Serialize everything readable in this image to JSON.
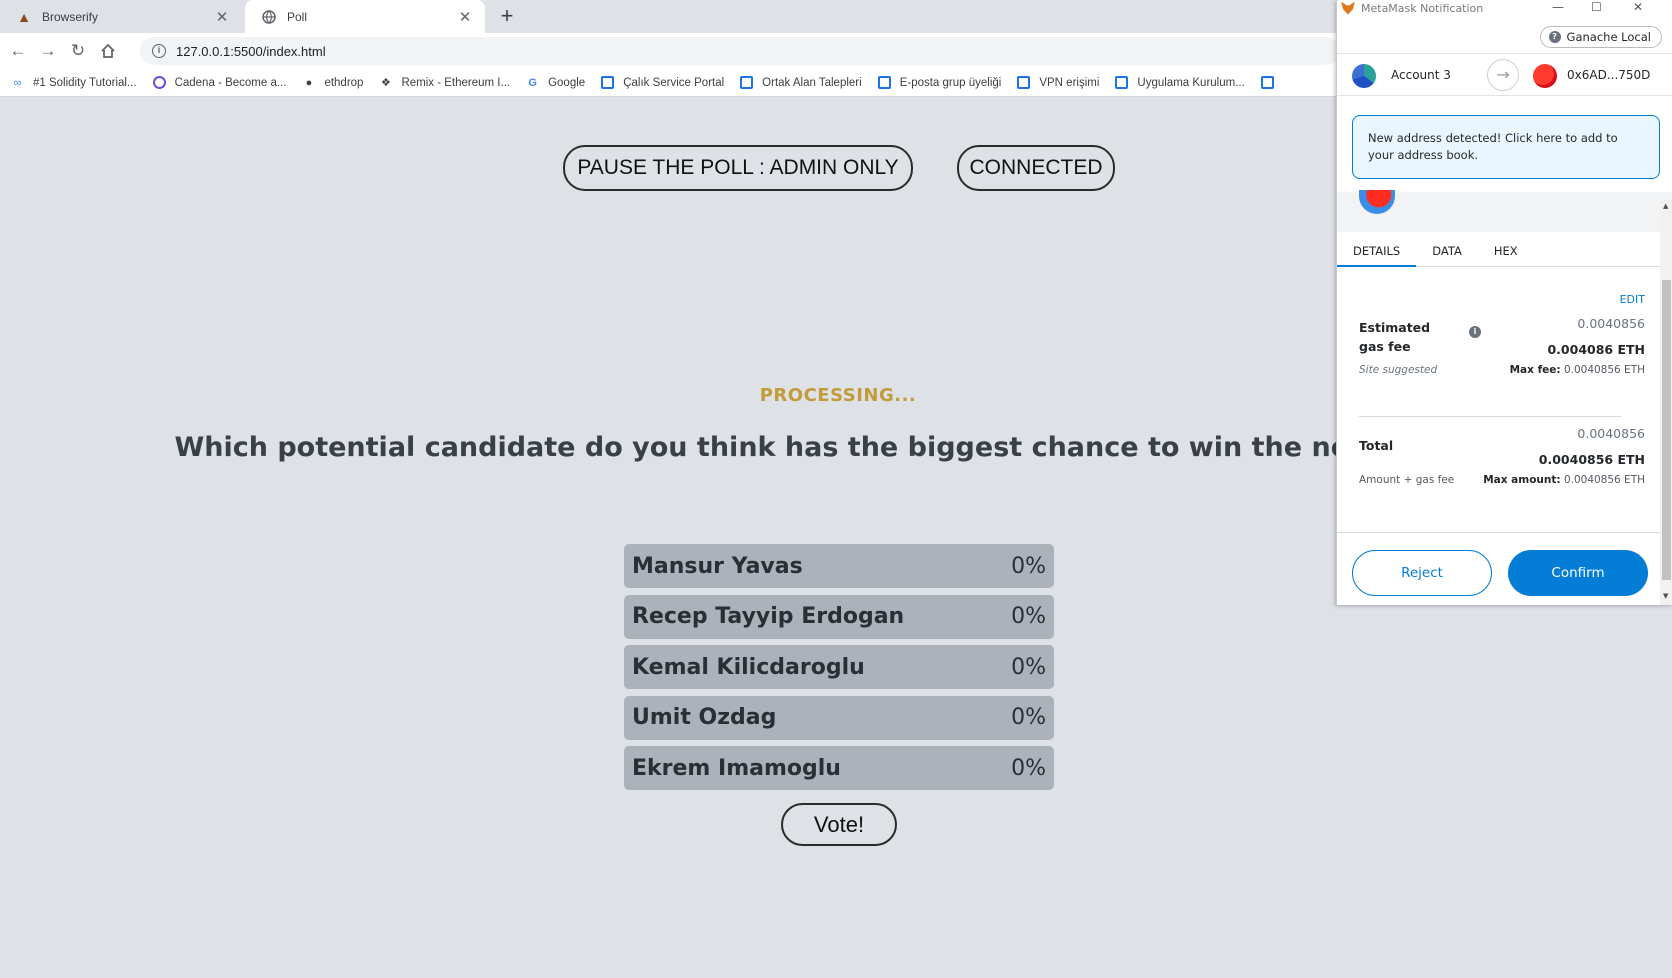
{
  "browser": {
    "tabs": [
      {
        "title": "Browserify",
        "active": false,
        "icon": "hat-icon"
      },
      {
        "title": "Poll",
        "active": true,
        "icon": "globe-icon"
      }
    ],
    "url": "127.0.0.1:5500/index.html",
    "bookmarks": [
      {
        "label": "#1 Solidity Tutorial...",
        "icon": "link-icon"
      },
      {
        "label": "Cadena - Become a...",
        "icon": "circle-icon"
      },
      {
        "label": "ethdrop",
        "icon": "drop-icon"
      },
      {
        "label": "Remix - Ethereum I...",
        "icon": "remix-icon"
      },
      {
        "label": "Google",
        "icon": "google-icon"
      },
      {
        "label": "Çalık Service Portal",
        "icon": "square-icon"
      },
      {
        "label": "Ortak Alan Talepleri",
        "icon": "square-icon"
      },
      {
        "label": "E-posta grup üyeliği",
        "icon": "square-icon"
      },
      {
        "label": "VPN erişimi",
        "icon": "square-icon"
      },
      {
        "label": "Uygulama Kurulum...",
        "icon": "square-icon"
      },
      {
        "label": "",
        "icon": "square-icon"
      }
    ]
  },
  "poll": {
    "pause_label": "PAUSE THE POLL : ADMIN ONLY",
    "connected_label": "CONNECTED",
    "status": "PROCESSING...",
    "question": "Which potential candidate do you think has the biggest chance to win the next Turkey?",
    "options": [
      {
        "name": "Mansur Yavas",
        "percent": "0%"
      },
      {
        "name": "Recep Tayyip Erdogan",
        "percent": "0%"
      },
      {
        "name": "Kemal Kilicdaroglu",
        "percent": "0%"
      },
      {
        "name": "Umit Ozdag",
        "percent": "0%"
      },
      {
        "name": "Ekrem Imamoglu",
        "percent": "0%"
      }
    ],
    "vote_label": "Vote!"
  },
  "metamask": {
    "window_title": "MetaMask Notification",
    "network": "Ganache Local",
    "from_account": "Account 3",
    "to_address": "0x6AD...750D",
    "notice": "New address detected! Click here to add to your address book.",
    "tabs": [
      "DETAILS",
      "DATA",
      "HEX"
    ],
    "edit_label": "EDIT",
    "gas_label": "Estimated gas fee",
    "gas_value": "0.0040856",
    "gas_eth": "0.004086 ETH",
    "site_suggested": "Site suggested",
    "max_fee_label": "Max fee:",
    "max_fee_value": "0.0040856 ETH",
    "total_label": "Total",
    "total_value": "0.0040856",
    "total_eth": "0.0040856 ETH",
    "amount_gas_label": "Amount + gas fee",
    "max_amount_label": "Max amount:",
    "max_amount_value": "0.0040856 ETH",
    "reject_label": "Reject",
    "confirm_label": "Confirm",
    "colors": {
      "primary": "#037dd6",
      "notice_bg": "#eaf6ff"
    }
  },
  "colors": {
    "page_bg": "#dee1e6",
    "status": "#c29b3b",
    "option_bg": "#acb2ba"
  }
}
